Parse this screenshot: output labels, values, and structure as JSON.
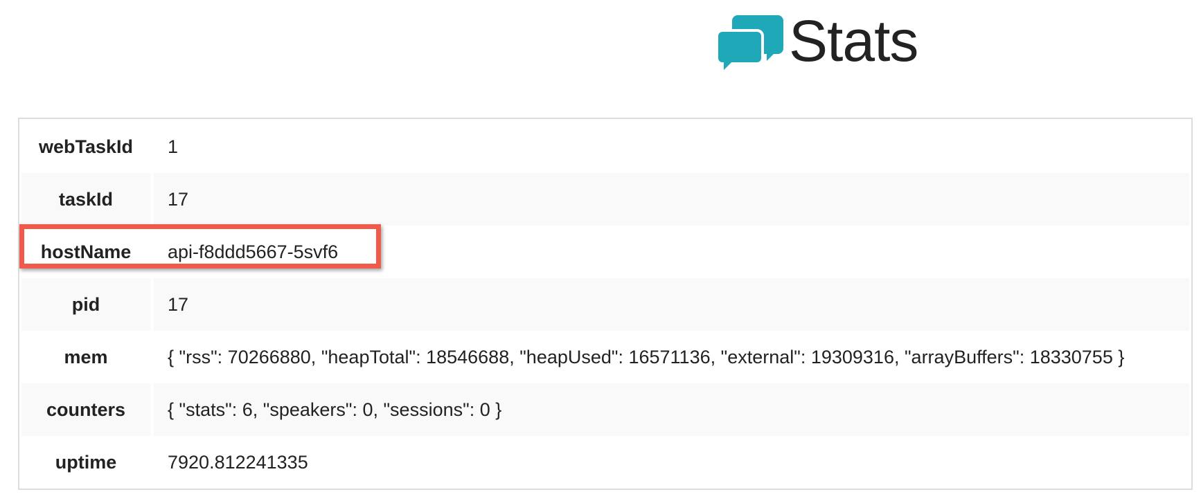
{
  "header": {
    "title": "Stats",
    "logo_icon": "chat-bubbles-icon",
    "logo_color": "#1fa8b8"
  },
  "rows": [
    {
      "key": "webTaskId",
      "value": "1"
    },
    {
      "key": "taskId",
      "value": "17"
    },
    {
      "key": "hostName",
      "value": "api-f8ddd5667-5svf6"
    },
    {
      "key": "pid",
      "value": "17"
    },
    {
      "key": "mem",
      "value": "{ \"rss\": 70266880, \"heapTotal\": 18546688, \"heapUsed\": 16571136, \"external\": 19309316, \"arrayBuffers\": 18330755 }"
    },
    {
      "key": "counters",
      "value": "{ \"stats\": 6, \"speakers\": 0, \"sessions\": 0 }"
    },
    {
      "key": "uptime",
      "value": "7920.812241335"
    }
  ],
  "highlight": {
    "color": "#f05a4a",
    "target_row": "hostName"
  }
}
